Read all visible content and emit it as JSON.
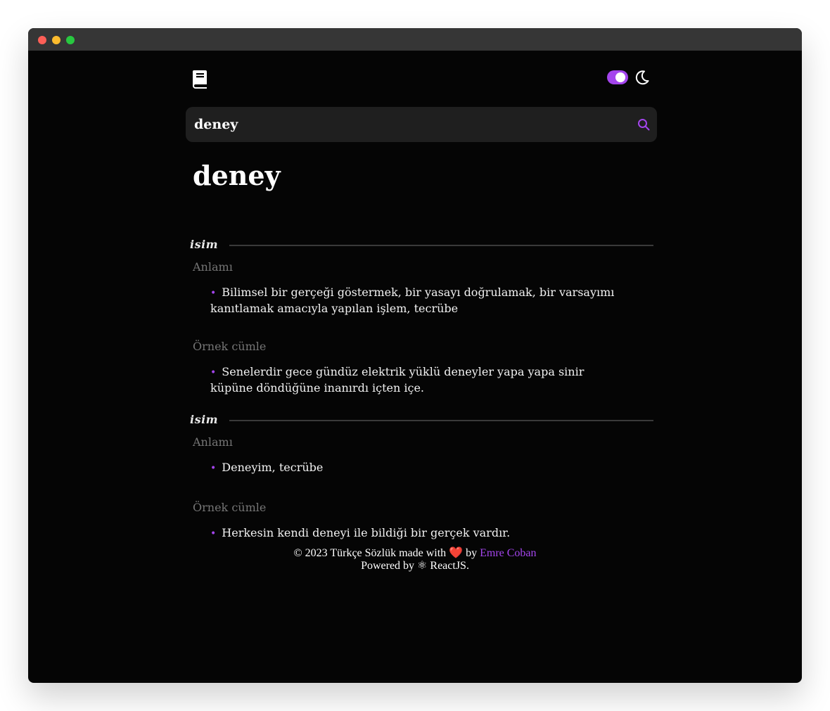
{
  "window": {
    "controls": [
      "close",
      "minimize",
      "zoom"
    ]
  },
  "header": {
    "logo_icon": "book-icon",
    "theme_toggle_on": true,
    "theme_icon": "moon-icon"
  },
  "search": {
    "value": "deney",
    "icon": "search-icon"
  },
  "word": "deney",
  "meanings": [
    {
      "pos": "isim",
      "meaning_label": "Anlamı",
      "meaning": "Bilimsel bir gerçeği göstermek, bir yasayı doğrulamak, bir varsayımı kanıtlamak amacıyla yapılan işlem, tecrübe",
      "example_label": "Örnek cümle",
      "example": "Senelerdir gece gündüz elektrik yüklü deneyler yapa yapa sinir küpüne döndüğüne inanırdı içten içe."
    },
    {
      "pos": "isim",
      "meaning_label": "Anlamı",
      "meaning": "Deneyim, tecrübe",
      "example_label": "Örnek cümle",
      "example": "Herkesin kendi deneyi ile bildiği bir gerçek vardır."
    }
  ],
  "footer": {
    "text_before": "© 2023 Türkçe Sözlük made with",
    "heart": "❤️",
    "by": "by",
    "author": "Emre Coban",
    "powered_prefix": "Powered by",
    "react_icon": "⚛",
    "powered_suffix": "ReactJS."
  },
  "colors": {
    "accent": "#a445ed",
    "background": "#050505",
    "search_bg": "#1f1f1f"
  }
}
